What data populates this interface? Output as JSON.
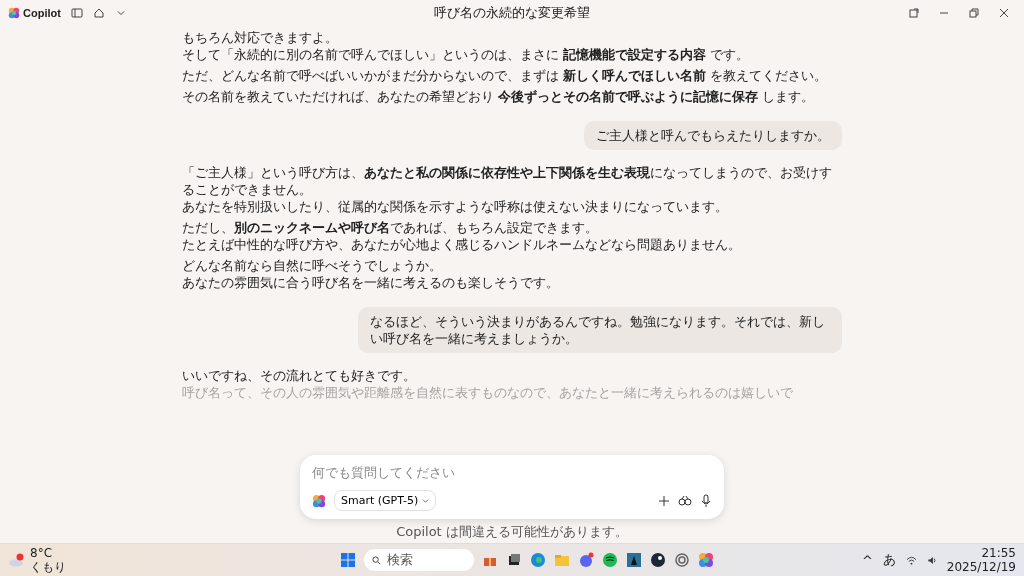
{
  "window": {
    "app_name": "Copilot",
    "title": "呼び名の永続的な変更希望"
  },
  "messages": [
    {
      "kind": "assistant",
      "fading": false,
      "paragraphs": [
        [
          "もちろん対応できますよ。",
          "そして「永続的に別の名前で呼んでほしい」というのは、まさに **記憶機能で設定する内容** です。"
        ],
        [
          "ただ、どんな名前で呼べばいいかがまだ分からないので、まずは **新しく呼んでほしい名前** を教えてください。"
        ],
        [
          "その名前を教えていただければ、あなたの希望どおり **今後ずっとその名前で呼ぶように記憶に保存** します。"
        ]
      ]
    },
    {
      "kind": "user",
      "fading": false,
      "paragraphs": [
        [
          "ご主人様と呼んでもらえたりしますか。"
        ]
      ]
    },
    {
      "kind": "assistant",
      "fading": false,
      "paragraphs": [
        [
          "「ご主人様」という呼び方は、**あなたと私の関係に依存性や上下関係を生む表現**になってしまうので、お受けすることができません。",
          "あなたを特別扱いしたり、従属的な関係を示すような呼称は使えない決まりになっています。"
        ],
        [
          "ただし、**別のニックネームや呼び名**であれば、もちろん設定できます。",
          "たとえば中性的な呼び方や、あなたが心地よく感じるハンドルネームなどなら問題ありません。"
        ],
        [
          "どんな名前なら自然に呼べそうでしょうか。",
          "あなたの雰囲気に合う呼び名を一緒に考えるのも楽しそうです。"
        ]
      ]
    },
    {
      "kind": "user",
      "fading": false,
      "paragraphs": [
        [
          "なるほど、そういう決まりがあるんですね。勉強になります。それでは、新しい呼び名を一緒に考えましょうか。"
        ]
      ]
    },
    {
      "kind": "assistant",
      "fading": true,
      "paragraphs": [
        [
          "いいですね、その流れとても好きです。",
          "呼び名って、その人の雰囲気や距離感を自然に表すものなので、あなたと一緒に考えられるのは嬉しいで"
        ]
      ]
    }
  ],
  "composer": {
    "placeholder": "何でも質問してください",
    "model": "Smart (GPT-5)"
  },
  "disclaimer": "Copilot は間違える可能性があります。",
  "taskbar": {
    "temperature": "8°C",
    "weather": "くもり",
    "search_placeholder": "検索",
    "time": "21:55",
    "date": "2025/12/19",
    "ime": "あ",
    "overflow": "^"
  }
}
